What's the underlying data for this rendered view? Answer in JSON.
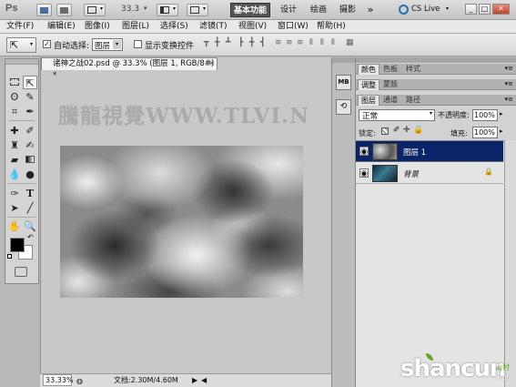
{
  "titlebar": {
    "app_logo": "Ps",
    "zoom_value": "33.3",
    "workspaces": [
      "基本功能",
      "设计",
      "绘画",
      "摄影"
    ],
    "more_label": "»",
    "cslive_label": "CS Live",
    "min_label": "_",
    "max_label": "□",
    "close_label": "✕"
  },
  "menubar": {
    "items": [
      "文件(F)",
      "编辑(E)",
      "图像(I)",
      "图层(L)",
      "选择(S)",
      "滤镜(T)",
      "视图(V)",
      "窗口(W)",
      "帮助(H)"
    ]
  },
  "options": {
    "auto_select_label": "自动选择:",
    "auto_select_value": "图层",
    "show_transform_label": "显示变换控件"
  },
  "document": {
    "tab_title": "诸神之战02.psd @ 33.3% (图层 1, RGB/8#) *",
    "tab_close": "×",
    "zoom_status": "33.33%",
    "doc_size": "文档:2.30M/4.60M"
  },
  "panels": {
    "top_tabs": [
      "颜色",
      "色板",
      "样式"
    ],
    "mid_tabs": [
      "调整",
      "蒙版"
    ],
    "layer_tabs": [
      "图层",
      "通道",
      "路径"
    ],
    "blend_mode": "正常",
    "opacity_label": "不透明度:",
    "opacity_value": "100%",
    "lock_label": "锁定:",
    "fill_label": "填充:",
    "fill_value": "100%",
    "layers": [
      {
        "name": "图层 1",
        "selected": true
      },
      {
        "name": "背景",
        "selected": false
      }
    ]
  },
  "watermarks": {
    "top": "騰龍視覺WWW.TLVI.N",
    "brand": "shancun",
    "brand_net": ".net",
    "brand_cn": "山村"
  }
}
